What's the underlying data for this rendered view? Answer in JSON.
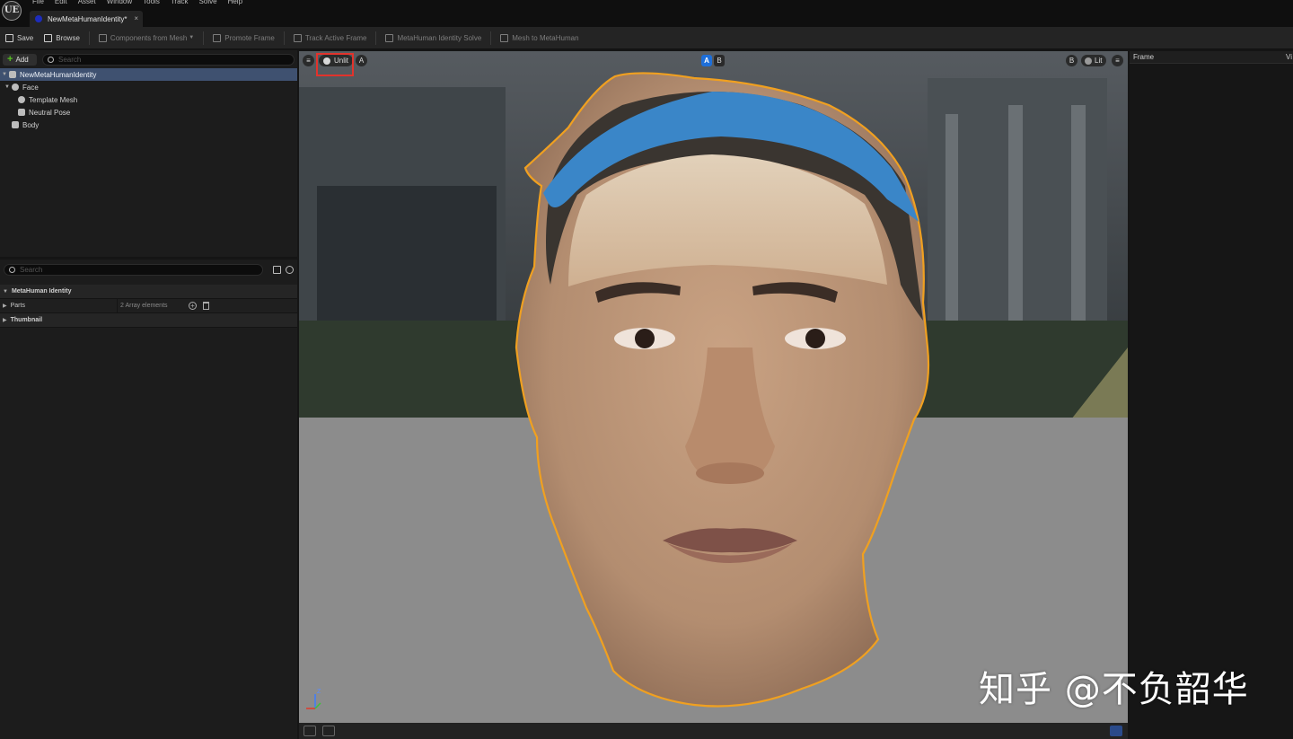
{
  "app": {
    "logo": "UE",
    "menu": [
      "File",
      "Edit",
      "Asset",
      "Window",
      "Tools",
      "Track",
      "Solve",
      "Help"
    ],
    "doc_tab": "NewMetaHumanIdentity*",
    "doc_tab_close": "×"
  },
  "toolbar": {
    "save": "Save",
    "browse": "Browse",
    "components_from_mesh": "Components from Mesh",
    "promote_frame": "Promote Frame",
    "track_active_frame": "Track Active Frame",
    "identity_solve": "MetaHuman Identity Solve",
    "mesh_to_metahuman": "Mesh to MetaHuman"
  },
  "components": {
    "add_label": "Add",
    "search_placeholder": "Search",
    "tree": [
      {
        "label": "NewMetaHumanIdentity",
        "icon": "identity-icon",
        "selected": true
      },
      {
        "label": "Face",
        "icon": "face-icon"
      },
      {
        "label": "Template Mesh",
        "icon": "mesh-icon"
      },
      {
        "label": "Neutral Pose",
        "icon": "pose-icon"
      },
      {
        "label": "Body",
        "icon": "body-icon"
      }
    ]
  },
  "details": {
    "search_placeholder": "Search",
    "category": "MetaHuman Identity",
    "parts_label": "Parts",
    "parts_value": "2 Array elements",
    "thumbnail_label": "Thumbnail"
  },
  "viewport": {
    "view_mode_left": "Unlit",
    "a_label": "A",
    "ab_a": "A",
    "ab_b": "B",
    "b_label": "B",
    "view_mode_right": "Lit",
    "axis_z": "Z",
    "colors": {
      "outline": "#f0a020",
      "headband": "#3a86c8",
      "highlight": "#e2332c",
      "ab_active": "#1e6fd9"
    }
  },
  "right_panel": {
    "header": "Frame",
    "header_right": "Vi"
  },
  "watermark": "知乎 @不负韶华"
}
